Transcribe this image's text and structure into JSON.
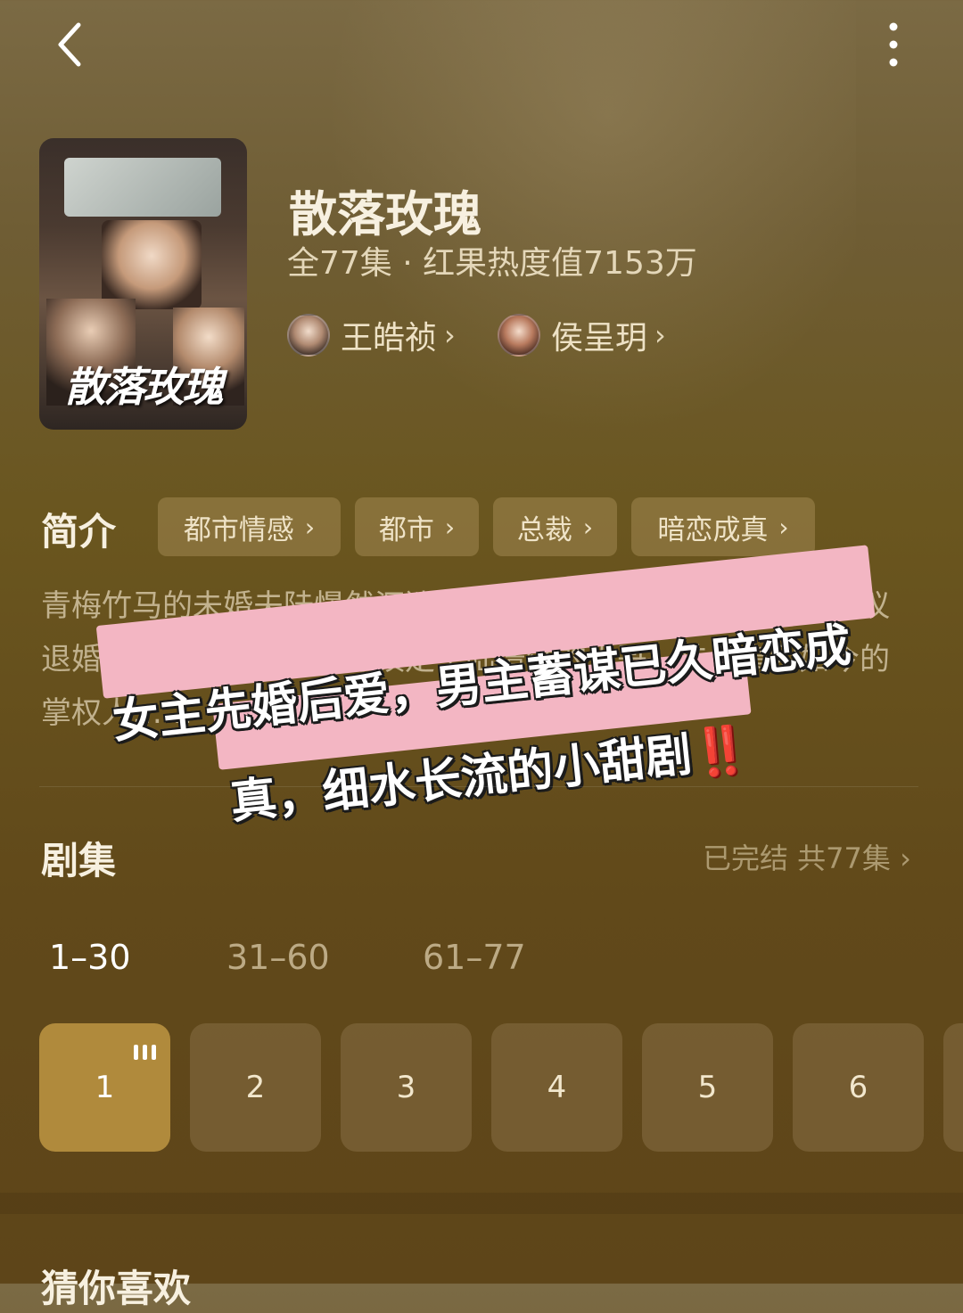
{
  "header": {
    "back_icon": "chevron-left-icon",
    "more_icon": "more-vertical-icon"
  },
  "drama": {
    "title": "散落玫瑰",
    "meta": "全77集 · 红果热度值7153万",
    "poster_title": "散落玫瑰",
    "cast": [
      {
        "name": "王皓祯",
        "icon": "avatar-icon"
      },
      {
        "name": "侯呈玥",
        "icon": "avatar-icon"
      }
    ]
  },
  "intro": {
    "label": "简介",
    "tags": [
      "都市情感",
      "都市",
      "总裁",
      "暗恋成真"
    ],
    "synopsis": "青梅竹马的未婚夫陆憬然沉迷于拯救灰姑娘的游戏，沈今懿决议退婚另择人选，竟把目标锁定了陆憬然的大哥，陆氏集团如今的掌权人……"
  },
  "sticker": {
    "line1": "女主先婚后爱，男主蓄谋已久暗恋成",
    "line2": "真，细水长流的小甜剧",
    "exclaim": "‼️"
  },
  "episodes": {
    "label": "剧集",
    "status": "已完结 共77集",
    "ranges": [
      "1–30",
      "31–60",
      "61–77"
    ],
    "active_range": "1–30",
    "items": [
      "1",
      "2",
      "3",
      "4",
      "5",
      "6"
    ],
    "playing": "1"
  },
  "recommend": {
    "label": "猜你喜欢"
  },
  "colors": {
    "active_episode": "#b08a3c",
    "background": "#6a561f",
    "sticker_band": "#f3b6c3",
    "exclaim": "#e0251f"
  }
}
